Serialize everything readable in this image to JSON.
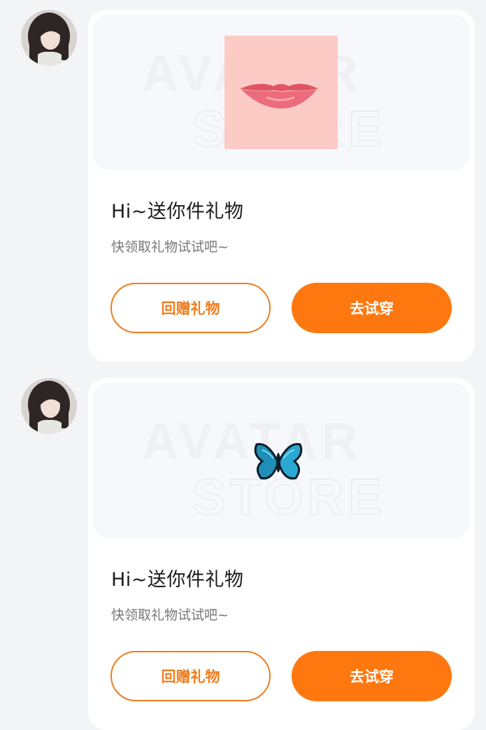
{
  "colors": {
    "accent": "#ff770f",
    "accent_outline": "#f07d1c",
    "page_background": "#f3f4f6",
    "card_background": "#ffffff"
  },
  "watermark": {
    "line1": "AVATAR",
    "line2": "STORE"
  },
  "messages": [
    {
      "gift_icon": "lips-sticker",
      "title": "Hi~送你件礼物",
      "subtitle": "快领取礼物试试吧~",
      "return_gift_label": "回赠礼物",
      "try_on_label": "去试穿"
    },
    {
      "gift_icon": "butterfly-sticker",
      "title": "Hi~送你件礼物",
      "subtitle": "快领取礼物试试吧~",
      "return_gift_label": "回赠礼物",
      "try_on_label": "去试穿"
    }
  ]
}
